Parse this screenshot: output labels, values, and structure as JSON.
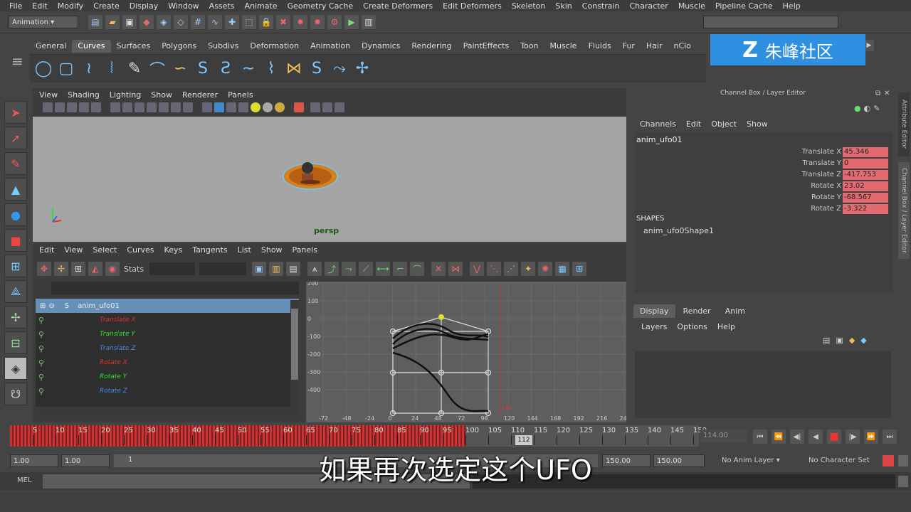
{
  "menu": [
    "File",
    "Edit",
    "Modify",
    "Create",
    "Display",
    "Window",
    "Assets",
    "Animate",
    "Geometry Cache",
    "Create Deformers",
    "Edit Deformers",
    "Skeleton",
    "Skin",
    "Constrain",
    "Character",
    "Muscle",
    "Pipeline Cache",
    "Help"
  ],
  "module": "Animation",
  "shelf_tabs": [
    "General",
    "Curves",
    "Surfaces",
    "Polygons",
    "Subdivs",
    "Deformation",
    "Animation",
    "Dynamics",
    "Rendering",
    "PaintEffects",
    "Toon",
    "Muscle",
    "Fluids",
    "Fur",
    "Hair",
    "nClo"
  ],
  "active_shelf": "Curves",
  "viewport": {
    "menu": [
      "View",
      "Shading",
      "Lighting",
      "Show",
      "Renderer",
      "Panels"
    ],
    "camera": "persp"
  },
  "graph_editor": {
    "menu": [
      "Edit",
      "View",
      "Select",
      "Curves",
      "Keys",
      "Tangents",
      "List",
      "Show",
      "Panels"
    ],
    "stats_label": "Stats",
    "object": "anim_ufo01",
    "channels": [
      {
        "name": "Translate X",
        "color": "#e03030"
      },
      {
        "name": "Translate Y",
        "color": "#30e030"
      },
      {
        "name": "Translate Z",
        "color": "#4a8ae0"
      },
      {
        "name": "Rotate X",
        "color": "#e03030"
      },
      {
        "name": "Rotate Y",
        "color": "#30e030"
      },
      {
        "name": "Rotate Z",
        "color": "#4a8ae0"
      }
    ],
    "y_ticks": [
      "200",
      "100",
      "0",
      "-100",
      "-200",
      "-300",
      "-400"
    ],
    "x_ticks": [
      "-72",
      "-48",
      "-24",
      "0",
      "24",
      "48",
      "72",
      "96",
      "120",
      "144",
      "168",
      "192",
      "216",
      "24"
    ],
    "current_frame": "120"
  },
  "channel_box": {
    "title": "Channel Box / Layer Editor",
    "menu": [
      "Channels",
      "Edit",
      "Object",
      "Show"
    ],
    "object": "anim_ufo01",
    "attrs": [
      {
        "name": "Translate X",
        "value": "45.346"
      },
      {
        "name": "Translate Y",
        "value": "0"
      },
      {
        "name": "Translate Z",
        "value": "-417.753"
      },
      {
        "name": "Rotate X",
        "value": "23.02"
      },
      {
        "name": "Rotate Y",
        "value": "-68.567"
      },
      {
        "name": "Rotate Z",
        "value": "-3.322"
      }
    ],
    "shapes_label": "SHAPES",
    "shape": "anim_ufo0Shape1"
  },
  "layer_editor": {
    "tabs": [
      "Display",
      "Render",
      "Anim"
    ],
    "menu": [
      "Layers",
      "Options",
      "Help"
    ]
  },
  "side_tabs": [
    "Attribute Editor",
    "Channel Box / Layer Editor"
  ],
  "timeline": {
    "ticks": [
      "5",
      "10",
      "15",
      "20",
      "25",
      "30",
      "35",
      "40",
      "45",
      "50",
      "55",
      "60",
      "65",
      "70",
      "75",
      "80",
      "85",
      "90",
      "95",
      "100",
      "105",
      "110",
      "115",
      "120",
      "125",
      "130",
      "135",
      "140",
      "145",
      "150"
    ],
    "current": "112",
    "current_field": "114.00"
  },
  "range": {
    "start": "1.00",
    "start2": "1.00",
    "slider": "1",
    "end": "150.00",
    "end2": "150.00",
    "anim_layer": "No Anim Layer",
    "char_set": "No Character Set"
  },
  "cmd": {
    "label": "MEL"
  },
  "subtitle": "如果再次选定这个UFO",
  "watermark": "朱峰社区"
}
